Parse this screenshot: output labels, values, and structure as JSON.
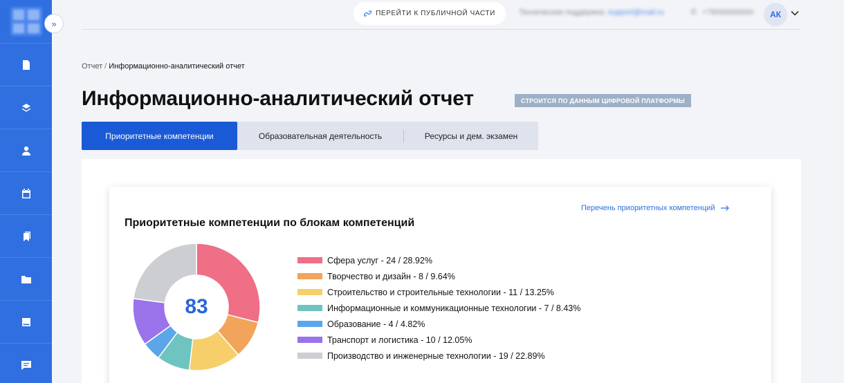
{
  "sidebar": {
    "items": [
      {
        "icon": "document-icon"
      },
      {
        "icon": "layers-icon"
      },
      {
        "icon": "user-icon"
      },
      {
        "icon": "calendar-icon"
      },
      {
        "icon": "bookmark-icon"
      },
      {
        "icon": "folder-icon"
      },
      {
        "icon": "book-icon"
      },
      {
        "icon": "chat-icon"
      }
    ],
    "color": "#2f6fe0"
  },
  "topbar": {
    "public_button": "ПЕРЕЙТИ К ПУБЛИЧНОЙ ЧАСТИ",
    "avatar": "АК"
  },
  "breadcrumb": {
    "root": "Отчет",
    "separator": "/",
    "current": "Информационно-аналитический отчет"
  },
  "page": {
    "title": "Информационно-аналитический отчет",
    "badge": "СТРОИТСЯ ПО ДАННЫМ ЦИФРОВОЙ ПЛАТФОРМЫ"
  },
  "tabs": [
    {
      "label": "Приоритетные компетенции",
      "active": true
    },
    {
      "label": "Образовательная деятельность",
      "active": false
    },
    {
      "label": "Ресурсы и дем. экзамен",
      "active": false
    }
  ],
  "card": {
    "link": "Перечень приоритетных компетенций",
    "title": "Приоритетные компетенции по блокам компетенций",
    "total": "83"
  },
  "chart_data": {
    "type": "pie",
    "center_label": "83",
    "slices": [
      {
        "label": "Сфера услуг - 24 / 28.92%",
        "value": 24,
        "color": "#ee6f86"
      },
      {
        "label": "Творчество и дизайн - 8 / 9.64%",
        "value": 8,
        "color": "#f2a45a"
      },
      {
        "label": "Строительство и строительные технологии - 11 / 13.25%",
        "value": 11,
        "color": "#f7cf6a"
      },
      {
        "label": "Информационные и коммуникационные технологии - 7 / 8.43%",
        "value": 7,
        "color": "#6fc4c0"
      },
      {
        "label": "Образование - 4 / 4.82%",
        "value": 4,
        "color": "#5ba6e8"
      },
      {
        "label": "Транспорт и логистика - 10 / 12.05%",
        "value": 10,
        "color": "#9a72ea"
      },
      {
        "label": "Производство и инженерные технологии - 19 / 22.89%",
        "value": 19,
        "color": "#cdced2"
      }
    ]
  }
}
